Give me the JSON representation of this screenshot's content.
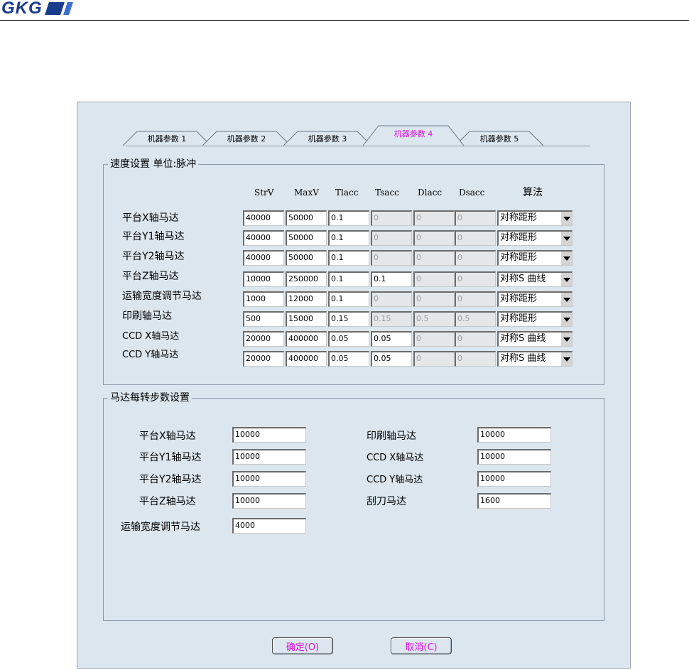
{
  "header": {
    "logo_text": "GKG"
  },
  "tabs": [
    {
      "label": "机器参数 1",
      "active": false
    },
    {
      "label": "机器参数 2",
      "active": false
    },
    {
      "label": "机器参数 3",
      "active": false
    },
    {
      "label": "机器参数 4",
      "active": true
    },
    {
      "label": "机器参数 5",
      "active": false
    }
  ],
  "speed": {
    "title": "速度设置 单位:脉冲",
    "columns": [
      "StrV",
      "MaxV",
      "Tlacc",
      "Tsacc",
      "Dlacc",
      "Dsacc"
    ],
    "algo_header": "算法",
    "rows": [
      {
        "label": "平台X轴马达",
        "values": [
          "40000",
          "50000",
          "0.1",
          "0",
          "0",
          "0"
        ],
        "algo": "对称距形"
      },
      {
        "label": "平台Y1轴马达",
        "values": [
          "40000",
          "50000",
          "0.1",
          "0",
          "0",
          "0"
        ],
        "algo": "对称距形"
      },
      {
        "label": "平台Y2轴马达",
        "values": [
          "40000",
          "50000",
          "0.1",
          "0",
          "0",
          "0"
        ],
        "algo": "对称距形"
      },
      {
        "label": "平台Z轴马达",
        "values": [
          "10000",
          "250000",
          "0.1",
          "0.1",
          "0",
          "0"
        ],
        "algo": "对称S 曲线"
      },
      {
        "label": "运输宽度调节马达",
        "values": [
          "1000",
          "12000",
          "0.1",
          "0",
          "0",
          "0"
        ],
        "algo": "对称距形"
      },
      {
        "label": "印刷轴马达",
        "values": [
          "500",
          "15000",
          "0.15",
          "0.15",
          "0.5",
          "0.5"
        ],
        "algo": "对称距形"
      },
      {
        "label": "CCD X轴马达",
        "values": [
          "20000",
          "400000",
          "0.05",
          "0.05",
          "0",
          "0"
        ],
        "algo": "对称S 曲线"
      },
      {
        "label": "CCD Y轴马达",
        "values": [
          "20000",
          "400000",
          "0.05",
          "0.05",
          "0",
          "0"
        ],
        "algo": "对称S 曲线"
      }
    ]
  },
  "steps": {
    "title": "马达每转步数设置",
    "left": [
      {
        "label": "平台X轴马达",
        "value": "10000"
      },
      {
        "label": "平台Y1轴马达",
        "value": "10000"
      },
      {
        "label": "平台Y2轴马达",
        "value": "10000"
      },
      {
        "label": "平台Z轴马达",
        "value": "10000"
      },
      {
        "label": "运输宽度调节马达",
        "value": "4000"
      }
    ],
    "right": [
      {
        "label": "印刷轴马达",
        "value": "10000"
      },
      {
        "label": "CCD X轴马达",
        "value": "10000"
      },
      {
        "label": "CCD Y轴马达",
        "value": "10000"
      },
      {
        "label": "刮刀马达",
        "value": "1600"
      }
    ]
  },
  "buttons": {
    "ok": "确定(O)",
    "cancel": "取消(C)"
  },
  "colors": {
    "dialog_bg": "#dbe6ee",
    "active_tab_text": "#e010e0",
    "logo": "#1a3c8c"
  }
}
